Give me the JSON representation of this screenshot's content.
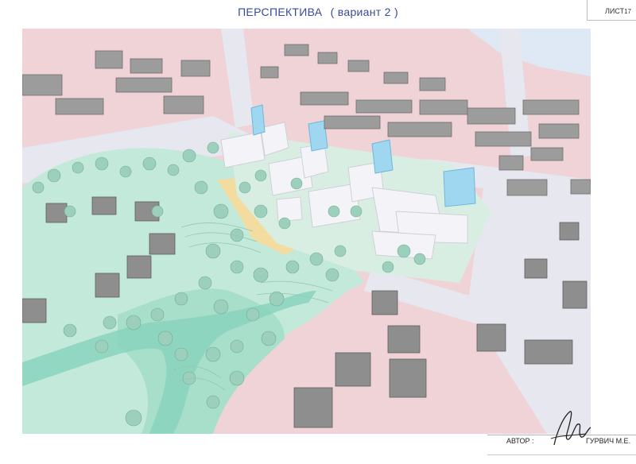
{
  "sheet": {
    "title": "ПЕРСПЕКТИВА",
    "variant": "( вариант 2 )",
    "sheet_label": "ЛИСТ",
    "sheet_number": "17"
  },
  "stamp": {
    "author_label": "АВТОР :",
    "author_name": "ГУРВИЧ М.Е."
  },
  "colors": {
    "ground": "#efd3d7",
    "road": "#e4e6ee",
    "greenery": "#bfe6d6",
    "stream": "#8ed4bf",
    "trees": "#9fd0bd",
    "houses": "#9a9a9a",
    "new_buildings": "#f4f4f7",
    "glass": "#8fd0ee",
    "sand": "#f2dca0"
  }
}
